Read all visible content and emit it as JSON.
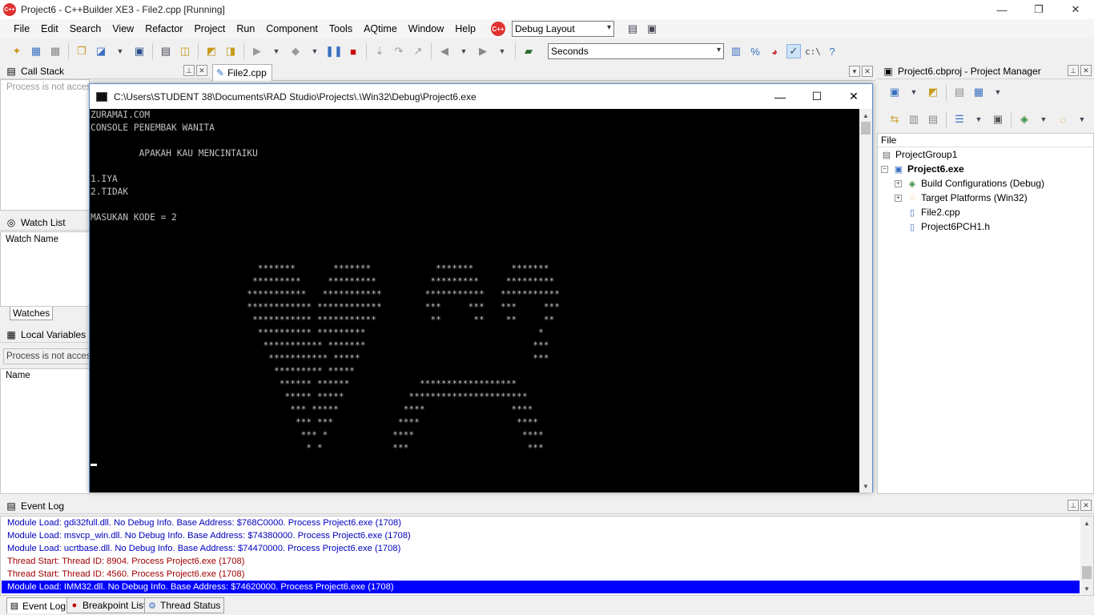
{
  "window": {
    "title": "Project6 - C++Builder XE3 - File2.cpp [Running]",
    "icon_label": "C++",
    "minimize": "—",
    "maximize": "❐",
    "close": "✕"
  },
  "menu": {
    "items": [
      "File",
      "Edit",
      "Search",
      "View",
      "Refactor",
      "Project",
      "Run",
      "Component",
      "Tools",
      "AQtime",
      "Window",
      "Help"
    ],
    "layout_combo": "Debug Layout",
    "seconds_combo": "Seconds",
    "path_glyph": "c:\\"
  },
  "call_stack": {
    "title": "Call Stack",
    "message": "Process is not accessible"
  },
  "editor": {
    "tab": "File2.cpp"
  },
  "watch_list": {
    "title": "Watch List",
    "column": "Watch Name",
    "tab": "Watches"
  },
  "local_variables": {
    "title": "Local Variables",
    "message": "Process is not accessible",
    "column": "Name"
  },
  "console": {
    "title": "C:\\Users\\STUDENT 38\\Documents\\RAD Studio\\Projects\\.\\Win32\\Debug\\Project6.exe",
    "lines": [
      "ZURAMAI.COM",
      "CONSOLE PENEMBAK WANITA",
      "",
      "         APAKAH KAU MENCINTAIKU",
      "",
      "1.IYA",
      "2.TIDAK",
      "",
      "MASUKAN KODE = 2",
      "",
      "",
      "",
      "                               *******       *******            *******       *******",
      "                              *********     *********          *********     *********",
      "                             ***********   ***********        ***********   ***********",
      "                             ************ ************        ***     ***   ***     ***",
      "                              *********** ***********          **      **    **     **",
      "                               ********** *********                                *",
      "                                *********** *******                               ***",
      "                                 *********** *****                                ***",
      "                                  ********* *****",
      "                                   ****** ******             ******************",
      "                                    ***** *****            **********************",
      "                                     *** *****            ****                ****",
      "                                      *** ***            ****                  ****",
      "                                       *** *            ****                    ****",
      "                                        * *             ***                      ***"
    ]
  },
  "project_manager": {
    "title": "Project6.cbproj - Project Manager",
    "column": "File",
    "tree": [
      {
        "label": "ProjectGroup1",
        "level": 0,
        "bold": false,
        "expander": ""
      },
      {
        "label": "Project6.exe",
        "level": 1,
        "bold": true,
        "expander": "−"
      },
      {
        "label": "Build Configurations (Debug)",
        "level": 2,
        "bold": false,
        "expander": "+"
      },
      {
        "label": "Target Platforms (Win32)",
        "level": 2,
        "bold": false,
        "expander": "+"
      },
      {
        "label": "File2.cpp",
        "level": 2,
        "bold": false,
        "expander": ""
      },
      {
        "label": "Project6PCH1.h",
        "level": 2,
        "bold": false,
        "expander": ""
      }
    ]
  },
  "event_log": {
    "title": "Event Log",
    "lines": [
      {
        "text": "Module Load: gdi32full.dll. No Debug Info. Base Address: $768C0000. Process Project6.exe (1708)",
        "color": "#0000c0"
      },
      {
        "text": "Module Load: msvcp_win.dll. No Debug Info. Base Address: $74380000. Process Project6.exe (1708)",
        "color": "#0000c0"
      },
      {
        "text": "Module Load: ucrtbase.dll. No Debug Info. Base Address: $74470000. Process Project6.exe (1708)",
        "color": "#0000c0"
      },
      {
        "text": "Thread Start: Thread ID: 8904. Process Project6.exe (1708)",
        "color": "#a00000"
      },
      {
        "text": "Thread Start: Thread ID: 4560. Process Project6.exe (1708)",
        "color": "#a00000"
      },
      {
        "text": "Module Load: IMM32.dll. No Debug Info. Base Address: $74620000. Process Project6.exe (1708)",
        "color": "#ffffff"
      }
    ],
    "selected_index": 5
  },
  "bottom_tabs": [
    "Event Log",
    "Breakpoint List",
    "Thread Status"
  ],
  "colors": {
    "selection": "#0000ff",
    "console_bg": "#000000",
    "console_fg": "#c0c0c0"
  }
}
